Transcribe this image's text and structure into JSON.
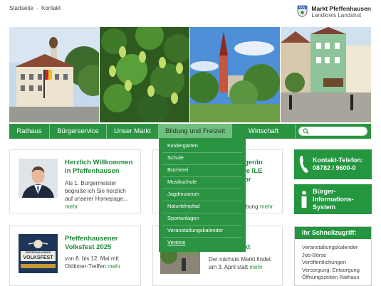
{
  "topbar": {
    "home": "Startseite",
    "separator": "·",
    "contact": "Kontakt"
  },
  "brand": {
    "name": "Markt Pfeffenhausen",
    "region": "Landkreis Landshut"
  },
  "nav": {
    "items": [
      {
        "label": "Rathaus"
      },
      {
        "label": "Bürgerservice"
      },
      {
        "label": "Unser Markt"
      },
      {
        "label": "Bildung und Freizeit"
      },
      {
        "label": "Wirtschaft"
      }
    ]
  },
  "dropdown": {
    "items": [
      "Kindergärten",
      "Schule",
      "Bücherei",
      "Musikschule",
      "Jagdmuseum",
      "Naturlehrpfad",
      "Sportanlagen",
      "Veranstaltungskalender",
      "Vereine"
    ]
  },
  "welcome": {
    "title_line1": "Herzlich Willkommen",
    "title_line2": "in Pfeffenhausen",
    "text_line1": "Als 1. Bürgermeister",
    "text_line2": "begrüße ich Sie herzlich",
    "text_line3": "auf unserer Homepage...",
    "more": "mehr"
  },
  "middle_card": {
    "title_line1": "ger/in",
    "title_line2": "le ILE",
    "title_line3": "or",
    "text": "ibung",
    "more": "mehr"
  },
  "festival": {
    "title_line1": "Pfeffenhausener",
    "title_line2": "Volksfest 2025",
    "text_line1": "von 8. bis 12. Mai mit",
    "text_line2": "Oldtimer-Treffen",
    "more": "mehr",
    "poster_top": "PFEFFENHAUSENER",
    "poster_main": "VOLKSFEST"
  },
  "market": {
    "title": "kt",
    "text_line1": "Der nächste Markt findet",
    "text_line2": "am 3. April statt",
    "more": "mehr"
  },
  "sidebar": {
    "phone_label": "Kontakt-Telefon:",
    "phone_number": "08782 / 9600-0",
    "info_line1": "Bürger-",
    "info_line2": "Informations-",
    "info_line3": "System"
  },
  "quick": {
    "heading": "Ihr Schnellzugriff:",
    "items": [
      "Veranstaltungskalender",
      "Job-Börse",
      "Veröffentlichungen",
      "Versorgung, Entsorgung",
      "Öffnungszeiten Rathaus"
    ]
  },
  "colors": {
    "brand_green": "#2a9443",
    "active_nav": "#6fbf7f"
  }
}
